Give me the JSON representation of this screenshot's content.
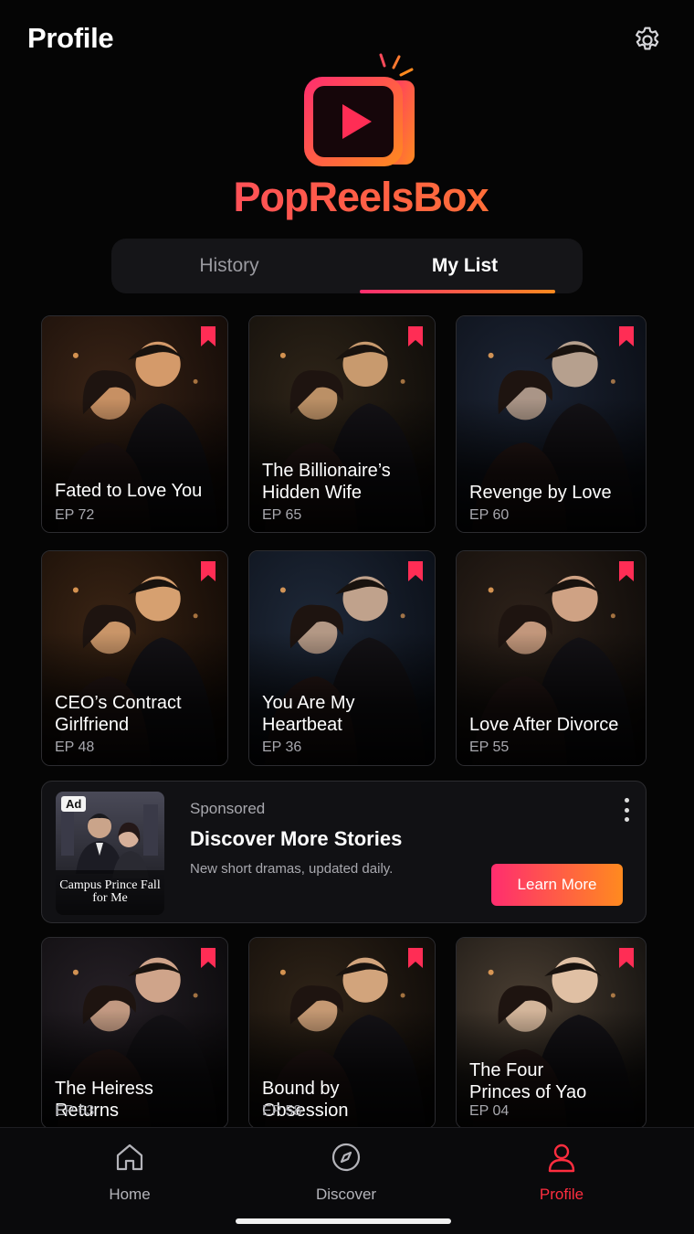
{
  "header": {
    "title": "Profile",
    "settings_icon": "gear-icon"
  },
  "brand": {
    "name": "PopReelsBox",
    "colors": [
      "#ff2d6f",
      "#ff8a1f"
    ]
  },
  "tabs": [
    {
      "label": "History",
      "active": false
    },
    {
      "label": "My List",
      "active": true
    }
  ],
  "my_list": [
    {
      "title": "Fated to Love You",
      "episode": "EP 72",
      "bookmarked": true
    },
    {
      "title": "The Billionaire’s Hidden Wife",
      "episode": "EP 65",
      "bookmarked": true
    },
    {
      "title": "Revenge by Love",
      "episode": "EP 60",
      "bookmarked": true
    },
    {
      "title": "CEO’s Contract Girlfriend",
      "episode": "EP 48",
      "bookmarked": true
    },
    {
      "title": "You Are My Heartbeat",
      "episode": "EP 36",
      "bookmarked": true
    },
    {
      "title": "Love After Divorce",
      "episode": "EP 55",
      "bookmarked": true
    },
    {
      "title": "The Heiress Returns",
      "episode": "EP 63",
      "bookmarked": true
    },
    {
      "title": "Bound by Obsession",
      "episode": "EP 58",
      "bookmarked": true
    },
    {
      "title": "The Four Princes of Yao",
      "episode": "EP 04",
      "bookmarked": true
    }
  ],
  "ad": {
    "badge": "Ad",
    "thumb_title": "Campus Prince Fall for Me",
    "sponsored": "Sponsored",
    "title": "Discover More Stories",
    "description": "New short dramas, updated daily.",
    "cta": "Learn More"
  },
  "bottom_nav": [
    {
      "label": "Home",
      "icon": "home-icon",
      "active": false
    },
    {
      "label": "Discover",
      "icon": "compass-icon",
      "active": false
    },
    {
      "label": "Profile",
      "icon": "user-icon",
      "active": true
    }
  ],
  "colors": {
    "accent": "#ff2d3f",
    "background": "#050505",
    "card_border": "#2c2c30"
  }
}
